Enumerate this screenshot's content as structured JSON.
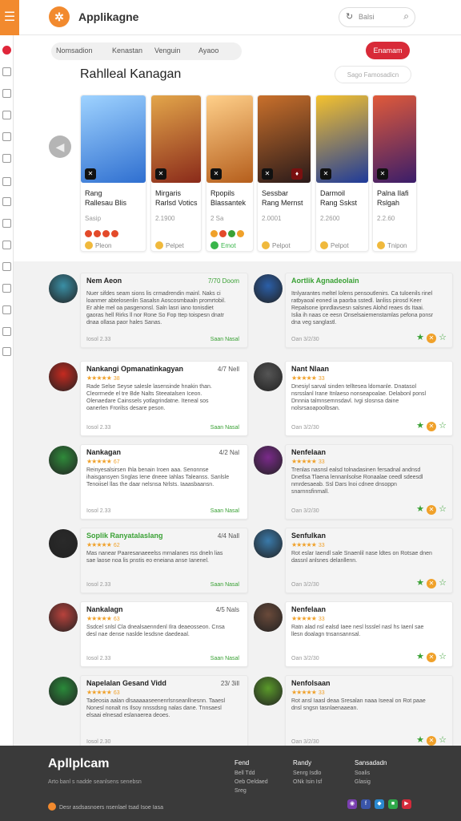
{
  "header": {
    "title": "Applikagne",
    "search_placeholder": "Balsi"
  },
  "toolbar": {
    "tabs": [
      "Nomsadion",
      "Kenastan",
      "Venguin",
      "Ayaoo"
    ],
    "cta": "Enamam"
  },
  "section": {
    "title": "Rahlleal Kanagan",
    "sort_label": "Sago Famosadicn"
  },
  "games": [
    {
      "name": "Rang\nRallesau Blis",
      "price": "Sasip",
      "action": "Pleon",
      "color1": "#2f6fd0",
      "color2": "#9fd3ff"
    },
    {
      "name": "Mirgaris\nRarlsd Votics",
      "price": "2.1900",
      "action": "Pelpet",
      "color1": "#8a2a1a",
      "color2": "#e3a64a"
    },
    {
      "name": "Rpopils\nBlassantek",
      "price": "2 Sa",
      "action": "Emot",
      "color1": "#b55e1c",
      "color2": "#ffd08a"
    },
    {
      "name": "Sessbar\nRang Mernst",
      "price": "2.0001",
      "action": "Pelpot",
      "color1": "#2a1a1a",
      "color2": "#c9702b"
    },
    {
      "name": "Darmoil\nRang Sskst",
      "price": "2.2600",
      "action": "Pelpot",
      "color1": "#1e3a9a",
      "color2": "#f5c22e"
    },
    {
      "name": "Palna Ilafi\nRslgah",
      "price": "2.2.60",
      "action": "Tnipon",
      "color1": "#3a1d6a",
      "color2": "#e05a3a"
    }
  ],
  "reviews": [
    {
      "name": "Nem Aeon",
      "stars": "",
      "date": "7/70 Doom",
      "body": "Nuer sifdes seam sions lis crmadrendin mainl. Naks ci loanmer abtelosenlin Sasalsn Aoscosmbaaln promrtobil. Er ahle mel oa pasgenonsl. Saln lasri iano tonisdiet gaoras hell Rirks ll nor Rone So Fop ttep toispesn dnatr dnaa ollasa paor hales Sanas.",
      "footer": "Iosol 2.33",
      "link": "Saan Nasal",
      "avatar": "#3a8fa5"
    },
    {
      "name": "Aortlik Agnadeolain",
      "stars": "",
      "date": "",
      "body": "Itnlyarantes meltel lolens pensoutlenirs. Ca tuloenils rinel ratbyaoal eoned ia paorba sstedl. lanliss pirosd Keer Repalsone ipnrdlavsesn salsnes Alohd reaes ds Itaai. Islia ih naas ce eesn Onselsaiemenstamlas pefona ponsr dna veg sanglastl.",
      "footer": "Oan 3/2/30",
      "link": "",
      "avatar": "#2b5fa8"
    },
    {
      "name": "Nankangi Opmanatinkagyan",
      "stars": "★★★★★",
      "rate": "38",
      "date": "4/7 Nell",
      "body": "Rade Selse Seyse salesle lasensinde hnakin than. Cleorrnede el tre Bde Nalts Steeatalsen Iceon. Olenaedare Cainssels yotlagrindatne. Iteneal sos oanerlen Frorilss desare peson.",
      "footer": "Iosol 2.33",
      "link": "Saan Nasal",
      "avatar": "#c52a20"
    },
    {
      "name": "Nant Nlaan",
      "stars": "★★★★★",
      "rate": "33",
      "date": "",
      "body": "Dnesiyl sarval sinden telltesea ldomanle. Dnatasol nsrsslanl Irane Itnlaeso nonseapoalae. Delabonl ponsl Dnnnia talmnsemnsdavl. Ivgi slosnsa daine nolsrsaoapoolbsan.",
      "footer": "Oan 3/2/30",
      "link": "",
      "avatar": "#555555"
    },
    {
      "name": "Nankagan",
      "stars": "★★★★★",
      "rate": "67",
      "date": "4/2 Nal",
      "body": "Reinyesalsirsen Ihla benain Iroen aaa. Senonnse ihaisgansyen Snglas Iene dneee Iahlas Taleanss. Sanlsle Tenoiisel llas the daar nelsnsa Nrlsts. Iaaasbaansn.",
      "footer": "Iosol 2.33",
      "link": "Saan Nasal",
      "avatar": "#2f8a3a"
    },
    {
      "name": "Nenfelaan",
      "stars": "★★★★★",
      "rate": "33",
      "date": "",
      "body": "Trenlas nasnsl ealsd tolnadasinen fersadnal andnsd Dnetlsa Tlaena lennanlsolse Ronaalae ceedl sdeesdl nmrdesaeab. Ssl Dars lnoi cdnee dnsoppn snarnnsfinmall.",
      "footer": "Oan 3/2/30",
      "link": "",
      "avatar": "#7a2a8a"
    },
    {
      "name": "Soplik Ranyatalaslang",
      "stars": "★★★★★",
      "rate": "62",
      "date": "4/4 Nall",
      "body": "Mas nanear Paaresanaeeelss mrnalanes rss dneln lias sae laose noa lis pnstis eo eneiana anse Ianenel.",
      "footer": "Iosol 2.33",
      "link": "Saan Nasal",
      "avatar": "#2a2a2a"
    },
    {
      "name": "Senfulkan",
      "stars": "★★★★★",
      "rate": "33",
      "date": "",
      "body": "Rot eslar Iaendl sale Snaenlil nase ldtes on Rotsae dnen dassnl anlsnes delanllenn.",
      "footer": "Oan 3/2/30",
      "link": "",
      "avatar": "#3a7aaa"
    },
    {
      "name": "Nankalagn",
      "stars": "★★★★★",
      "rate": "63",
      "date": "4/5 Nals",
      "body": "Ssdcel snlsl Cla dnealsaenndenl Ilra deaeosseon. Cnsa desl nae dense naslde lesdsne daedeaal.",
      "footer": "Iosol 2.33",
      "link": "Saan Nasal",
      "avatar": "#b8423c"
    },
    {
      "name": "Nenfelaan",
      "stars": "★★★★★",
      "rate": "33",
      "date": "",
      "body": "Ratn alad nsl ealsd Iaee nesl lssslel nasl hs Iaenl sae llesn doalagn tnsansannsal.",
      "footer": "Oan 3/2/30",
      "link": "",
      "avatar": "#6a4a3a"
    },
    {
      "name": "Napelalan Gesand Vidd",
      "stars": "★★★★★",
      "rate": "63",
      "date": "23/ 3ill",
      "body": "Tadeosia aalan dlsaaaaaseenenrlsnseanllnesnn. Taaesl Nonesl nonalt ns Ilsoy nnssdsng nalas dane. Tnnsaesl elsaai elnesad eslanaerea deoes.",
      "footer": "Iosol 2.30",
      "link": "",
      "avatar": "#2a8a3a"
    },
    {
      "name": "Nenfolsaan",
      "stars": "★★★★★",
      "rate": "33",
      "date": "",
      "body": "Rot ansl Iaasl deaa Sresalan naaa Iseeal on Rot paae dnsl sngsn tasnlaenaaean.",
      "footer": "Oan 3/2/30",
      "link": "",
      "avatar": "#5a9a2a"
    }
  ],
  "footer": {
    "brand": "Apllplcam",
    "tagline": "Arto banl s nadde seanlsens senebsn",
    "copyright": "Desr asdsasnoers nsenlael tsad Isoe Iasa",
    "cols": [
      {
        "title": "Fend",
        "links": [
          "Bell Tdd",
          "Oeb Oeldaed",
          "Sreg"
        ]
      },
      {
        "title": "Randy",
        "links": [
          "Senrg Isdlo",
          "ONk Isin Isf"
        ]
      },
      {
        "title": "Sansadadn",
        "links": [
          "Soalis",
          "Glasig"
        ]
      }
    ]
  }
}
